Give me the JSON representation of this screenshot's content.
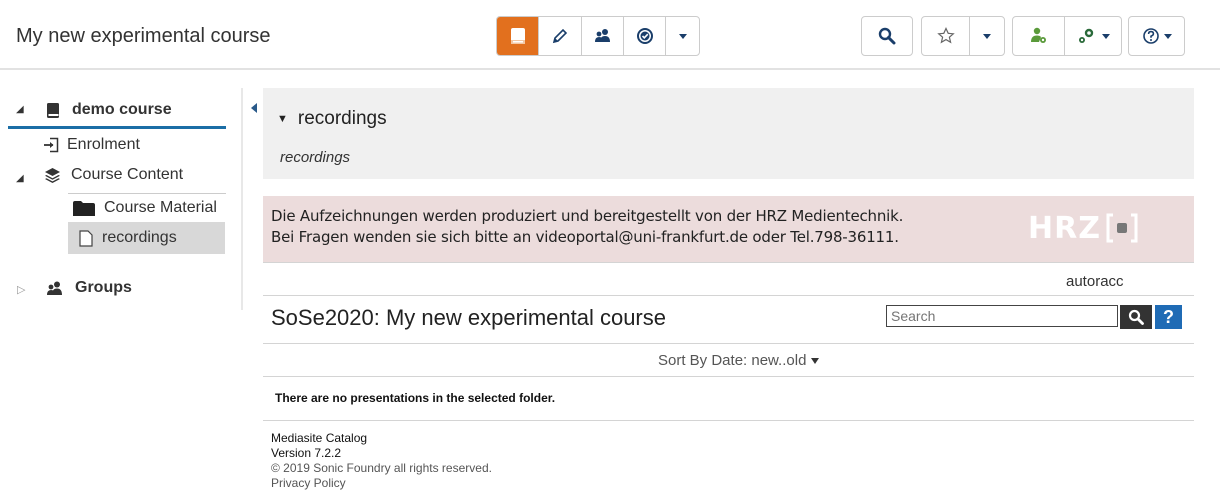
{
  "header": {
    "title": "My new experimental course"
  },
  "sidebar": {
    "root": {
      "label": "demo course"
    },
    "items": [
      {
        "label": "Enrolment"
      },
      {
        "label": "Course Content"
      },
      {
        "label": "Course Material"
      },
      {
        "label": "recordings"
      },
      {
        "label": "Groups"
      }
    ]
  },
  "main": {
    "heading": "recordings",
    "subtitle": "recordings",
    "notice_line1": "Die Aufzeichnungen werden produziert und bereitgestellt von der HRZ Medientechnik.",
    "notice_line2": "Bei Fragen wenden sie sich bitte an videoportal@uni-frankfurt.de oder Tel.798-36111.",
    "logo_text": "HRZ",
    "user": "autoracc",
    "catalog_title": "SoSe2020: My new experimental course",
    "search_placeholder": "Search",
    "help_label": "?",
    "sort_label": "Sort By Date: new..old",
    "empty_message": "There are no presentations in the selected folder.",
    "footer": {
      "line1": "Mediasite Catalog",
      "line2": "Version 7.2.2",
      "line3": "© 2019 Sonic Foundry all rights reserved.",
      "line4": "Privacy Policy"
    }
  },
  "colors": {
    "accent": "#e2701e",
    "primary": "#1b6ea6",
    "notice_bg": "#ecdcdc",
    "panel_bg": "#f0f0f0"
  }
}
